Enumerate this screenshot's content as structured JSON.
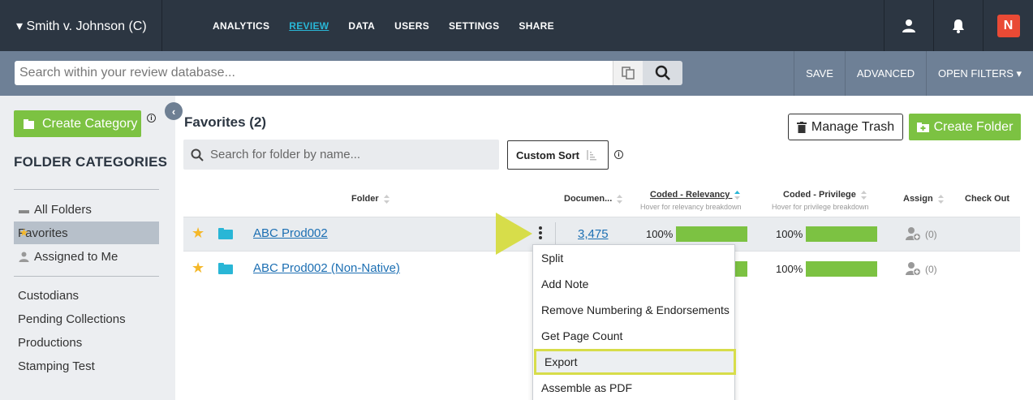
{
  "header": {
    "case_title": "▾ Smith v. Johnson (C)",
    "nav": [
      "ANALYTICS",
      "REVIEW",
      "DATA",
      "USERS",
      "SETTINGS",
      "SHARE"
    ],
    "active_nav": "REVIEW",
    "brand_badge": "N"
  },
  "search": {
    "placeholder": "Search within your review database...",
    "value": "",
    "save_label": "SAVE",
    "advanced_label": "ADVANCED",
    "open_filters_label": "OPEN FILTERS ▾"
  },
  "sidebar": {
    "create_category_label": "Create Category",
    "heading": "FOLDER CATEGORIES",
    "items_top": [
      {
        "label": "All Folders",
        "icon": "folder-icon",
        "active": false
      },
      {
        "label": "Favorites",
        "icon": "star-icon",
        "active": true
      },
      {
        "label": "Assigned to Me",
        "icon": "user-icon",
        "active": false
      }
    ],
    "items_bottom": [
      "Custodians",
      "Pending Collections",
      "Productions",
      "Stamping Test"
    ]
  },
  "main": {
    "title": "Favorites (2)",
    "manage_trash_label": "Manage Trash",
    "create_folder_label": "Create Folder",
    "folder_search_placeholder": "Search for folder by name...",
    "custom_sort_label": "Custom Sort",
    "columns": {
      "folder": "Folder",
      "documents": "Documen...",
      "coded_relevancy": "Coded - Relevancy",
      "coded_relevancy_sub": "Hover for relevancy breakdown",
      "coded_privilege": "Coded - Privilege",
      "coded_privilege_sub": "Hover for privilege breakdown",
      "assign": "Assign",
      "check_out": "Check Out"
    },
    "rows": [
      {
        "name": "ABC Prod002",
        "documents": "3,475",
        "relevancy_pct": "100%",
        "relevancy_value": 1.0,
        "privilege_pct": "100%",
        "privilege_value": 1.0,
        "assign_count": "(0)"
      },
      {
        "name": "ABC Prod002 (Non-Native)",
        "documents": "",
        "relevancy_pct": "",
        "relevancy_value": 1.0,
        "privilege_pct": "100%",
        "privilege_value": 1.0,
        "assign_count": "(0)"
      }
    ]
  },
  "context_menu": {
    "items": [
      "Split",
      "Add Note",
      "Remove Numbering & Endorsements",
      "Get Page Count",
      "Export",
      "Assemble as PDF"
    ],
    "highlighted": "Export"
  },
  "colors": {
    "topbar": "#2c3642",
    "searchbar": "#6e8096",
    "accent_green": "#7cc242",
    "link_blue": "#1c6fb3",
    "active_nav": "#29b6d6",
    "highlight_yellow": "#d7dd4a",
    "brand_red": "#e94a35"
  }
}
